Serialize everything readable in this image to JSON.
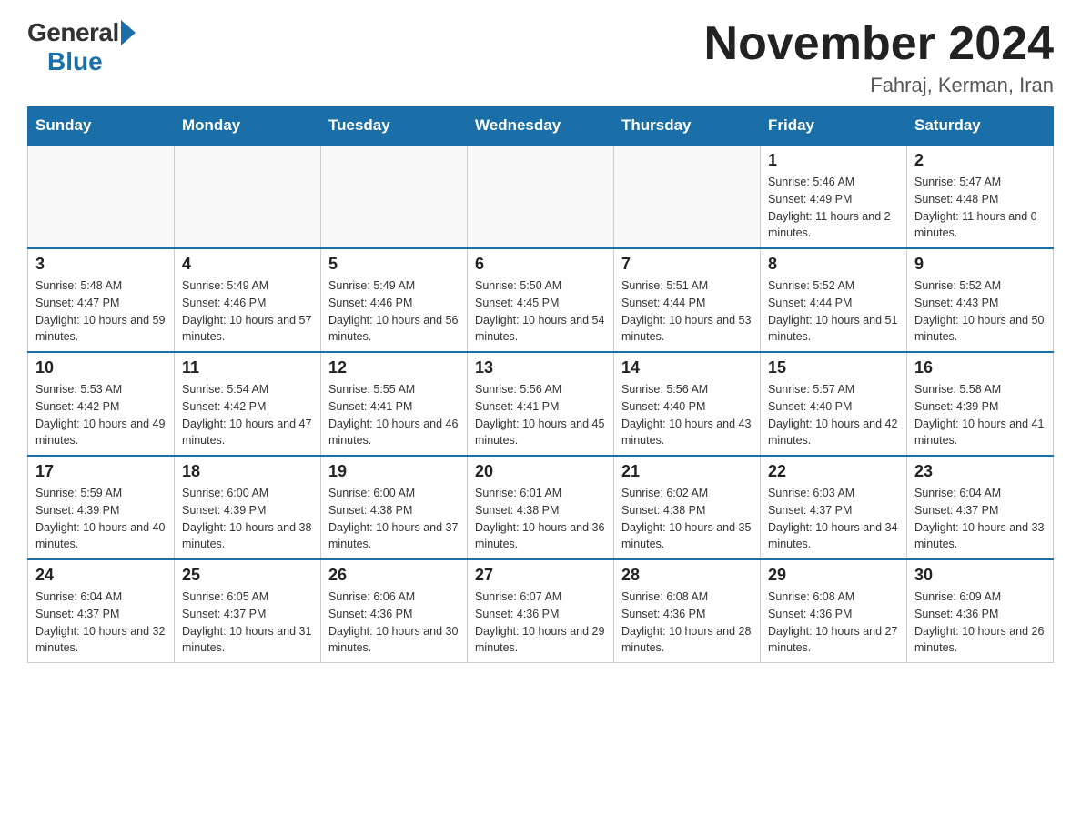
{
  "header": {
    "logo_general": "General",
    "logo_blue": "Blue",
    "month_title": "November 2024",
    "location": "Fahraj, Kerman, Iran"
  },
  "weekdays": [
    "Sunday",
    "Monday",
    "Tuesday",
    "Wednesday",
    "Thursday",
    "Friday",
    "Saturday"
  ],
  "weeks": [
    [
      {
        "day": "",
        "sunrise": "",
        "sunset": "",
        "daylight": ""
      },
      {
        "day": "",
        "sunrise": "",
        "sunset": "",
        "daylight": ""
      },
      {
        "day": "",
        "sunrise": "",
        "sunset": "",
        "daylight": ""
      },
      {
        "day": "",
        "sunrise": "",
        "sunset": "",
        "daylight": ""
      },
      {
        "day": "",
        "sunrise": "",
        "sunset": "",
        "daylight": ""
      },
      {
        "day": "1",
        "sunrise": "Sunrise: 5:46 AM",
        "sunset": "Sunset: 4:49 PM",
        "daylight": "Daylight: 11 hours and 2 minutes."
      },
      {
        "day": "2",
        "sunrise": "Sunrise: 5:47 AM",
        "sunset": "Sunset: 4:48 PM",
        "daylight": "Daylight: 11 hours and 0 minutes."
      }
    ],
    [
      {
        "day": "3",
        "sunrise": "Sunrise: 5:48 AM",
        "sunset": "Sunset: 4:47 PM",
        "daylight": "Daylight: 10 hours and 59 minutes."
      },
      {
        "day": "4",
        "sunrise": "Sunrise: 5:49 AM",
        "sunset": "Sunset: 4:46 PM",
        "daylight": "Daylight: 10 hours and 57 minutes."
      },
      {
        "day": "5",
        "sunrise": "Sunrise: 5:49 AM",
        "sunset": "Sunset: 4:46 PM",
        "daylight": "Daylight: 10 hours and 56 minutes."
      },
      {
        "day": "6",
        "sunrise": "Sunrise: 5:50 AM",
        "sunset": "Sunset: 4:45 PM",
        "daylight": "Daylight: 10 hours and 54 minutes."
      },
      {
        "day": "7",
        "sunrise": "Sunrise: 5:51 AM",
        "sunset": "Sunset: 4:44 PM",
        "daylight": "Daylight: 10 hours and 53 minutes."
      },
      {
        "day": "8",
        "sunrise": "Sunrise: 5:52 AM",
        "sunset": "Sunset: 4:44 PM",
        "daylight": "Daylight: 10 hours and 51 minutes."
      },
      {
        "day": "9",
        "sunrise": "Sunrise: 5:52 AM",
        "sunset": "Sunset: 4:43 PM",
        "daylight": "Daylight: 10 hours and 50 minutes."
      }
    ],
    [
      {
        "day": "10",
        "sunrise": "Sunrise: 5:53 AM",
        "sunset": "Sunset: 4:42 PM",
        "daylight": "Daylight: 10 hours and 49 minutes."
      },
      {
        "day": "11",
        "sunrise": "Sunrise: 5:54 AM",
        "sunset": "Sunset: 4:42 PM",
        "daylight": "Daylight: 10 hours and 47 minutes."
      },
      {
        "day": "12",
        "sunrise": "Sunrise: 5:55 AM",
        "sunset": "Sunset: 4:41 PM",
        "daylight": "Daylight: 10 hours and 46 minutes."
      },
      {
        "day": "13",
        "sunrise": "Sunrise: 5:56 AM",
        "sunset": "Sunset: 4:41 PM",
        "daylight": "Daylight: 10 hours and 45 minutes."
      },
      {
        "day": "14",
        "sunrise": "Sunrise: 5:56 AM",
        "sunset": "Sunset: 4:40 PM",
        "daylight": "Daylight: 10 hours and 43 minutes."
      },
      {
        "day": "15",
        "sunrise": "Sunrise: 5:57 AM",
        "sunset": "Sunset: 4:40 PM",
        "daylight": "Daylight: 10 hours and 42 minutes."
      },
      {
        "day": "16",
        "sunrise": "Sunrise: 5:58 AM",
        "sunset": "Sunset: 4:39 PM",
        "daylight": "Daylight: 10 hours and 41 minutes."
      }
    ],
    [
      {
        "day": "17",
        "sunrise": "Sunrise: 5:59 AM",
        "sunset": "Sunset: 4:39 PM",
        "daylight": "Daylight: 10 hours and 40 minutes."
      },
      {
        "day": "18",
        "sunrise": "Sunrise: 6:00 AM",
        "sunset": "Sunset: 4:39 PM",
        "daylight": "Daylight: 10 hours and 38 minutes."
      },
      {
        "day": "19",
        "sunrise": "Sunrise: 6:00 AM",
        "sunset": "Sunset: 4:38 PM",
        "daylight": "Daylight: 10 hours and 37 minutes."
      },
      {
        "day": "20",
        "sunrise": "Sunrise: 6:01 AM",
        "sunset": "Sunset: 4:38 PM",
        "daylight": "Daylight: 10 hours and 36 minutes."
      },
      {
        "day": "21",
        "sunrise": "Sunrise: 6:02 AM",
        "sunset": "Sunset: 4:38 PM",
        "daylight": "Daylight: 10 hours and 35 minutes."
      },
      {
        "day": "22",
        "sunrise": "Sunrise: 6:03 AM",
        "sunset": "Sunset: 4:37 PM",
        "daylight": "Daylight: 10 hours and 34 minutes."
      },
      {
        "day": "23",
        "sunrise": "Sunrise: 6:04 AM",
        "sunset": "Sunset: 4:37 PM",
        "daylight": "Daylight: 10 hours and 33 minutes."
      }
    ],
    [
      {
        "day": "24",
        "sunrise": "Sunrise: 6:04 AM",
        "sunset": "Sunset: 4:37 PM",
        "daylight": "Daylight: 10 hours and 32 minutes."
      },
      {
        "day": "25",
        "sunrise": "Sunrise: 6:05 AM",
        "sunset": "Sunset: 4:37 PM",
        "daylight": "Daylight: 10 hours and 31 minutes."
      },
      {
        "day": "26",
        "sunrise": "Sunrise: 6:06 AM",
        "sunset": "Sunset: 4:36 PM",
        "daylight": "Daylight: 10 hours and 30 minutes."
      },
      {
        "day": "27",
        "sunrise": "Sunrise: 6:07 AM",
        "sunset": "Sunset: 4:36 PM",
        "daylight": "Daylight: 10 hours and 29 minutes."
      },
      {
        "day": "28",
        "sunrise": "Sunrise: 6:08 AM",
        "sunset": "Sunset: 4:36 PM",
        "daylight": "Daylight: 10 hours and 28 minutes."
      },
      {
        "day": "29",
        "sunrise": "Sunrise: 6:08 AM",
        "sunset": "Sunset: 4:36 PM",
        "daylight": "Daylight: 10 hours and 27 minutes."
      },
      {
        "day": "30",
        "sunrise": "Sunrise: 6:09 AM",
        "sunset": "Sunset: 4:36 PM",
        "daylight": "Daylight: 10 hours and 26 minutes."
      }
    ]
  ]
}
